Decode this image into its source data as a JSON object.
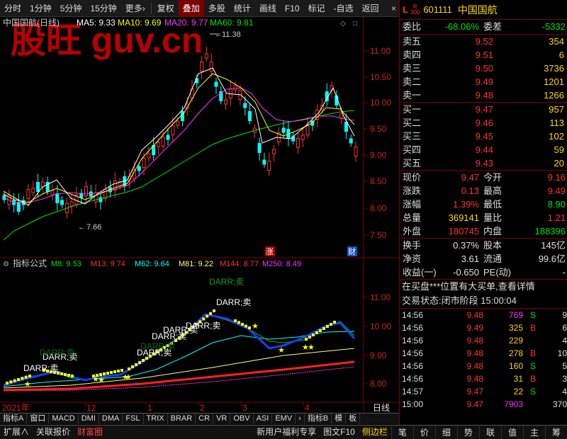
{
  "toolbar": {
    "items": [
      "分时",
      "1分钟",
      "5分钟",
      "15分钟",
      "更多",
      "复权",
      "叠加",
      "多股",
      "统计",
      "画线",
      "F10",
      "标记",
      "-自选",
      "返回"
    ],
    "more_suffix": "›",
    "close": "×"
  },
  "watermark": "股旺 guv.cn",
  "kline_legend": {
    "name": "中国国航(日线)",
    "ma5": "MA5: 9.33",
    "ma10": "MA10: 9.69",
    "ma20": "MA20: 9.77",
    "ma60": "MA60: 9.81"
  },
  "kline_axis": [
    "11.00",
    "10.50",
    "10.00",
    "9.50",
    "9.00",
    "8.50",
    "8.00",
    "7.50"
  ],
  "kline_marks": {
    "high": "11.38",
    "low": "7.66",
    "up": "涨",
    "fin": "财"
  },
  "indicator_legend": {
    "name": "指标公式",
    "m8": "M8: 9.53",
    "m13": "M13: 9.74",
    "m62": "M62: 9.64",
    "m81": "M81: 9.22",
    "m144": "M144: 8.77",
    "m250": "M250: 8.49"
  },
  "indicator_axis": [
    "11.00",
    "10.00",
    "9.00",
    "8.00"
  ],
  "signal_label": "DARR;卖",
  "x_axis": {
    "start": "2021年",
    "m12": "12",
    "m1": "1",
    "m2": "2",
    "m3": "3",
    "m4": "4",
    "period": "日线"
  },
  "tabs": [
    "指标A",
    "窗口",
    "MACD",
    "DMI",
    "DMA",
    "FSL",
    "TRIX",
    "BRAR",
    "CR",
    "VR",
    "OBV",
    "ASI",
    "EMV",
    "›",
    "指标B",
    "模",
    "板"
  ],
  "footer_left": [
    "扩展∧",
    "关联报价",
    "财富圈"
  ],
  "footer_mid": [
    "新用户福利专享",
    "图文F10",
    "侧边栏"
  ],
  "footer_right": [
    "笔",
    "价",
    "细",
    "势",
    "联",
    "值",
    "主",
    "筹"
  ],
  "quote": {
    "market": "L",
    "sup1": "R",
    "sup2": "300",
    "code": "601111",
    "name": "中国国航",
    "webi_label": "委比",
    "webi": "-68.06%",
    "wecha_label": "委差",
    "wecha": "-5332",
    "asks": [
      {
        "label": "卖五",
        "price": "9.52",
        "vol": "354"
      },
      {
        "label": "卖四",
        "price": "9.51",
        "vol": "6"
      },
      {
        "label": "卖三",
        "price": "9.50",
        "vol": "3736"
      },
      {
        "label": "卖二",
        "price": "9.49",
        "vol": "1201"
      },
      {
        "label": "卖一",
        "price": "9.48",
        "vol": "1266"
      }
    ],
    "bids": [
      {
        "label": "买一",
        "price": "9.47",
        "vol": "957"
      },
      {
        "label": "买二",
        "price": "9.46",
        "vol": "113"
      },
      {
        "label": "买三",
        "price": "9.45",
        "vol": "102"
      },
      {
        "label": "买四",
        "price": "9.44",
        "vol": "59"
      },
      {
        "label": "买五",
        "price": "9.43",
        "vol": "20"
      }
    ],
    "stats": [
      {
        "l1": "现价",
        "v1": "9.47",
        "l2": "今开",
        "v2": "9.16",
        "c1": "red",
        "c2": "red"
      },
      {
        "l1": "涨跌",
        "v1": "0.13",
        "l2": "最高",
        "v2": "9.49",
        "c1": "red",
        "c2": "red"
      },
      {
        "l1": "涨幅",
        "v1": "1.39%",
        "l2": "最低",
        "v2": "8.90",
        "c1": "red",
        "c2": "green"
      },
      {
        "l1": "总量",
        "v1": "369141",
        "l2": "量比",
        "v2": "1.21",
        "c1": "yellow",
        "c2": "red"
      },
      {
        "l1": "外盘",
        "v1": "180745",
        "l2": "内盘",
        "v2": "188396",
        "c1": "red",
        "c2": "green"
      }
    ],
    "fund": [
      {
        "l1": "换手",
        "v1": "0.37%",
        "l2": "股本",
        "v2": "145亿"
      },
      {
        "l1": "净资",
        "v1": "3.61",
        "l2": "流通",
        "v2": "99.6亿"
      },
      {
        "l1": "收益(一)",
        "v1": "-0.650",
        "l2": "PE(动)",
        "v2": "-"
      }
    ],
    "message": "在买盘***位置有大买单,查看详情",
    "status_label": "交易状态:",
    "status": "闭市阶段",
    "status_time": "15:00:04",
    "ticks": [
      {
        "time": "14:56",
        "price": "9.48",
        "vol": "769",
        "bs": "S",
        "n": "9",
        "vc": "magenta",
        "bc": "green"
      },
      {
        "time": "14:56",
        "price": "9.49",
        "vol": "325",
        "bs": "B",
        "n": "6",
        "vc": "yellow",
        "bc": "red"
      },
      {
        "time": "14:56",
        "price": "9.48",
        "vol": "229",
        "bs": "",
        "n": "4",
        "vc": "yellow",
        "bc": "white"
      },
      {
        "time": "14:56",
        "price": "9.48",
        "vol": "278",
        "bs": "B",
        "n": "10",
        "vc": "yellow",
        "bc": "red"
      },
      {
        "time": "14:56",
        "price": "9.48",
        "vol": "160",
        "bs": "S",
        "n": "5",
        "vc": "yellow",
        "bc": "green"
      },
      {
        "time": "14:56",
        "price": "9.48",
        "vol": "31",
        "bs": "B",
        "n": "3",
        "vc": "yellow",
        "bc": "red"
      },
      {
        "time": "14:57",
        "price": "9.47",
        "vol": "22",
        "bs": "S",
        "n": "4",
        "vc": "yellow",
        "bc": "green"
      },
      {
        "time": "15:00",
        "price": "9.47",
        "vol": "7903",
        "bs": "",
        "n": "370",
        "vc": "magenta",
        "bc": "white"
      }
    ]
  },
  "colors": {
    "up": "#ff3030",
    "down": "#00ffff",
    "ma5": "#ffffff",
    "ma10": "#ffff00",
    "ma20": "#ff30ff",
    "ma60": "#00e000",
    "frame": "#7a0000"
  }
}
